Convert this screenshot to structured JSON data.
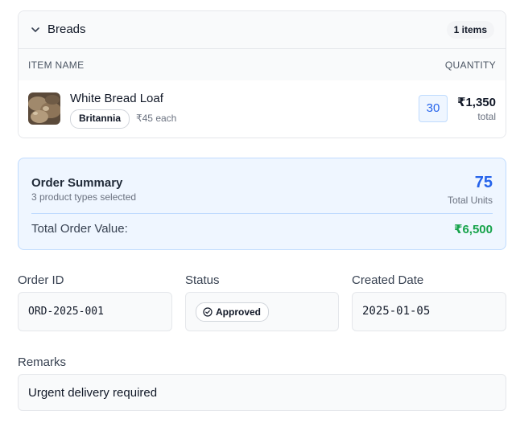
{
  "category": {
    "name": "Breads",
    "count_label": "1 items",
    "columns": {
      "item_name": "ITEM NAME",
      "quantity": "QUANTITY"
    },
    "items": [
      {
        "name": "White Bread Loaf",
        "brand": "Britannia",
        "unit_price": "₹45 each",
        "quantity": "30",
        "line_total": "₹1,350",
        "line_total_label": "total"
      }
    ]
  },
  "summary": {
    "title": "Order Summary",
    "subtitle": "3 product types selected",
    "total_units": "75",
    "total_units_label": "Total Units",
    "total_value_label": "Total Order Value:",
    "total_value": "₹6,500"
  },
  "fields": {
    "order_id": {
      "label": "Order ID",
      "value": "ORD-2025-001"
    },
    "status": {
      "label": "Status",
      "value": "Approved"
    },
    "created_date": {
      "label": "Created Date",
      "value": "2025-01-05"
    },
    "remarks": {
      "label": "Remarks",
      "value": "Urgent delivery required"
    }
  },
  "colors": {
    "accent_blue": "#2563eb",
    "summary_bg": "#eff6ff",
    "value_green": "#16a34a"
  },
  "icons": {
    "chevron": "chevron-down-icon",
    "status": "check-circle-icon",
    "thumbnail": "bread-thumbnail"
  }
}
